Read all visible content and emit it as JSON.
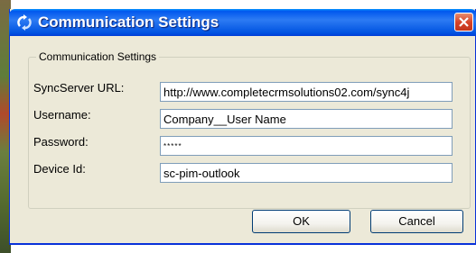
{
  "window": {
    "title": "Communication Settings",
    "close_icon": "close-icon",
    "app_icon": "sync-app-icon",
    "title_bar_color": "#0058ee",
    "close_button_color": "#d7442a"
  },
  "group": {
    "legend": "Communication Settings"
  },
  "fields": {
    "syncserver_url": {
      "label": "SyncServer URL:",
      "value": "http://www.completecrmsolutions02.com/sync4j"
    },
    "username": {
      "label": "Username:",
      "value": "Company__User Name"
    },
    "password": {
      "label": "Password:",
      "value": "*****"
    },
    "device_id": {
      "label": "Device Id:",
      "value": "sc-pim-outlook"
    }
  },
  "buttons": {
    "ok": "OK",
    "cancel": "Cancel"
  }
}
